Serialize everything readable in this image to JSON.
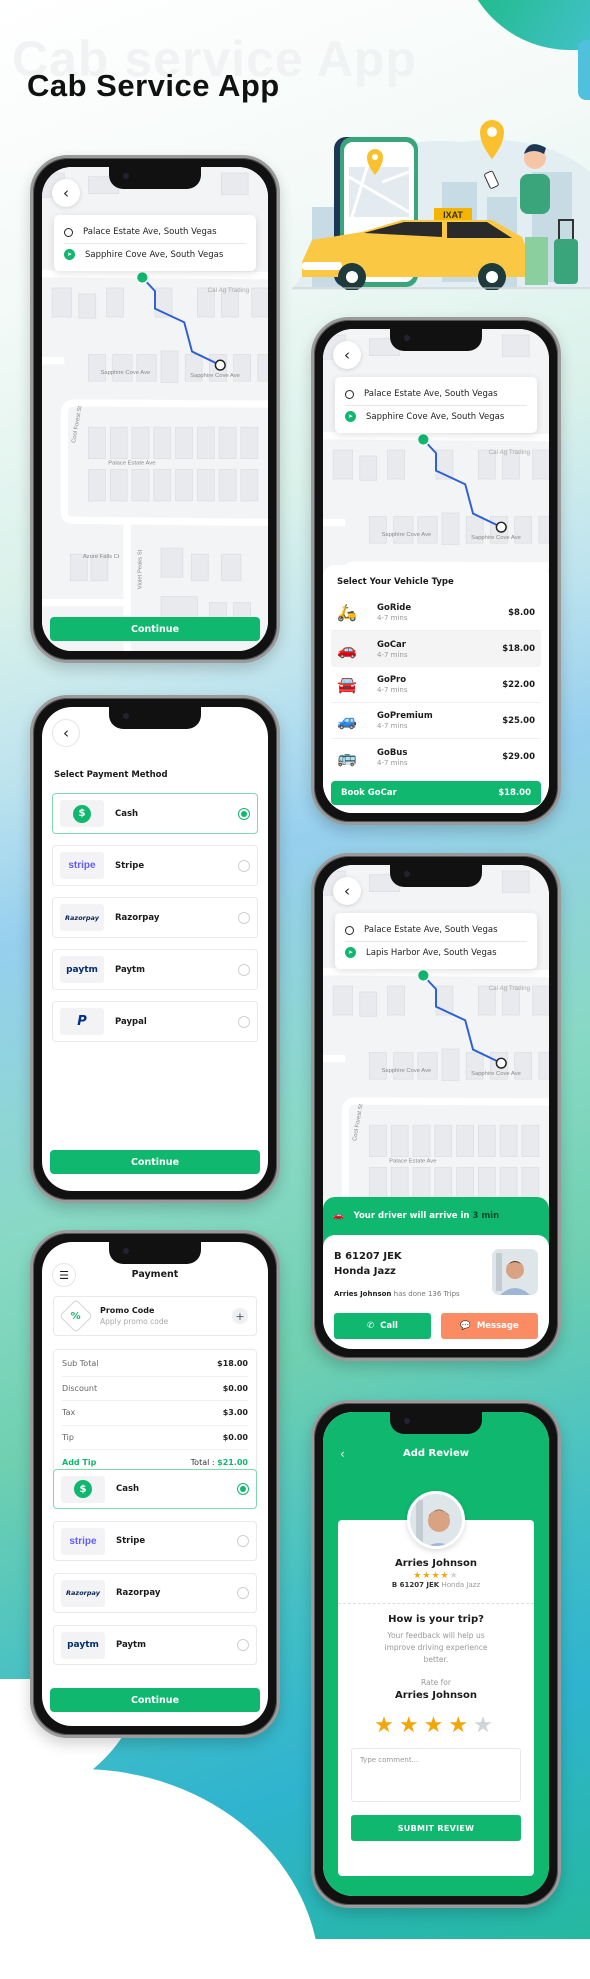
{
  "page": {
    "ghost_title": "Cab service App",
    "title": "Cab Service App"
  },
  "illustration": {
    "taxi_sign": "IXAT"
  },
  "colors": {
    "brand_green": "#10b86f",
    "message_orange": "#fb8b63",
    "route_blue": "#2c5fd6",
    "star_gold": "#f2a60b"
  },
  "map_labels": {
    "lapis": "Lapis Harbor Ave",
    "cal_ag": "Cal Ag Trading",
    "sapphire1": "Sapphire Cove Ave",
    "sapphire2": "Sapphire Cove Ave",
    "cool_forest": "Cool Forest St",
    "palace": "Palace Estate Ave",
    "azure": "Azure Falls Ct",
    "violet": "Violet Peaks St"
  },
  "screen1": {
    "back_icon": "chevron-left",
    "pickup": "Palace Estate Ave, South Vegas",
    "destination": "Sapphire Cove Ave, South Vegas",
    "continue_label": "Continue"
  },
  "screen2": {
    "pickup": "Palace Estate Ave, South Vegas",
    "destination": "Sapphire Cove Ave, South Vegas",
    "sheet_title": "Select Your Vehicle Type",
    "vehicles": [
      {
        "name": "GoRide",
        "eta": "4-7 mins",
        "price": "$8.00",
        "icon": "scooter-icon"
      },
      {
        "name": "GoCar",
        "eta": "4-7 mins",
        "price": "$18.00",
        "icon": "car-icon",
        "selected": true
      },
      {
        "name": "GoPro",
        "eta": "4-7 mins",
        "price": "$22.00",
        "icon": "sedan-icon"
      },
      {
        "name": "GoPremium",
        "eta": "4-7 mins",
        "price": "$25.00",
        "icon": "suv-icon"
      },
      {
        "name": "GoBus",
        "eta": "4-7 mins",
        "price": "$29.00",
        "icon": "bus-icon"
      }
    ],
    "book_label": "Book GoCar",
    "book_price": "$18.00"
  },
  "screen3": {
    "title": "Select Payment Method",
    "methods": [
      {
        "label": "Cash",
        "logo": "$",
        "selected": true
      },
      {
        "label": "Stripe",
        "logo": "stripe"
      },
      {
        "label": "Razorpay",
        "logo": "Razorpay"
      },
      {
        "label": "Paytm",
        "logo": "paytm"
      },
      {
        "label": "Paypal",
        "logo": "P"
      }
    ],
    "continue_label": "Continue"
  },
  "screen4": {
    "pickup": "Palace Estate Ave, South Vegas",
    "destination": "Lapis Harbor Ave, South Vegas",
    "arrive_prefix": "Your driver will arrive in",
    "arrive_time": "3 min",
    "plate": "B 61207 JEK",
    "car": "Honda Jazz",
    "driver_name": "Arries Johnson",
    "trips_text": "has done 136 Trips",
    "call_label": "Call",
    "message_label": "Message"
  },
  "screen5": {
    "title": "Payment",
    "promo_title": "Promo Code",
    "promo_sub": "Apply promo code",
    "summary": [
      {
        "label": "Sub Total",
        "value": "$18.00"
      },
      {
        "label": "Discount",
        "value": "$0.00"
      },
      {
        "label": "Tax",
        "value": "$3.00"
      },
      {
        "label": "Tip",
        "value": "$0.00"
      }
    ],
    "add_tip": "Add Tip",
    "total_label": "Total :",
    "total_value": "$21.00",
    "methods": [
      {
        "label": "Cash",
        "logo": "$",
        "selected": true
      },
      {
        "label": "Stripe",
        "logo": "stripe"
      },
      {
        "label": "Razorpay",
        "logo": "Razorpay"
      },
      {
        "label": "Paytm",
        "logo": "paytm"
      }
    ],
    "continue_label": "Continue"
  },
  "screen6": {
    "title": "Add Review",
    "driver_name": "Arries Johnson",
    "driver_rating": 4,
    "rating_max": 5,
    "plate": "B 61207 JEK",
    "car": "Honda Jazz",
    "question": "How is your trip?",
    "subtitle": "Your feedback will help us improve driving experience better.",
    "rate_for": "Rate for",
    "rate_name": "Arries Johnson",
    "user_rating": 4,
    "comment_placeholder": "Type comment...",
    "submit_label": "SUBMIT REVIEW"
  }
}
